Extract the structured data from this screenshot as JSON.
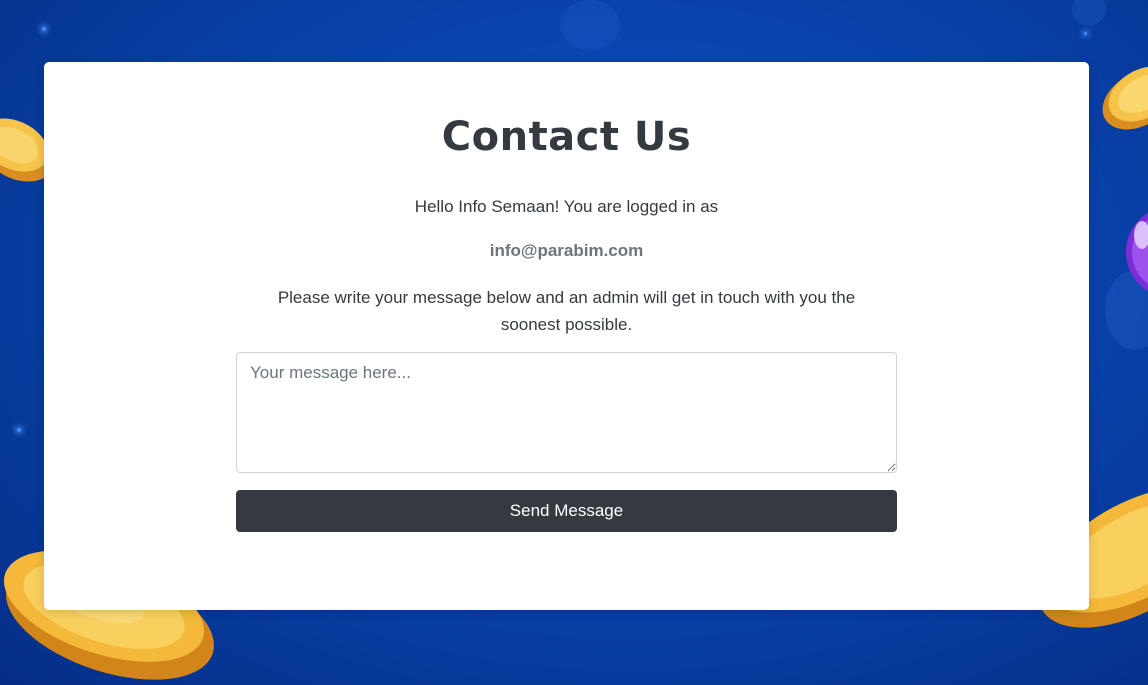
{
  "contact": {
    "title": "Contact Us",
    "greeting": "Hello Info Semaan! You are logged in as",
    "email": "info@parabim.com",
    "instructions": "Please write your message below and an admin will get in touch with you the soonest possible.",
    "message_placeholder": "Your message here...",
    "message_value": "",
    "send_label": "Send Message"
  },
  "colors": {
    "background": "#0a47b3",
    "card": "#ffffff",
    "heading": "#343a40",
    "email": "#6c757d",
    "button": "#343a40",
    "coin": "#f4b93a"
  }
}
